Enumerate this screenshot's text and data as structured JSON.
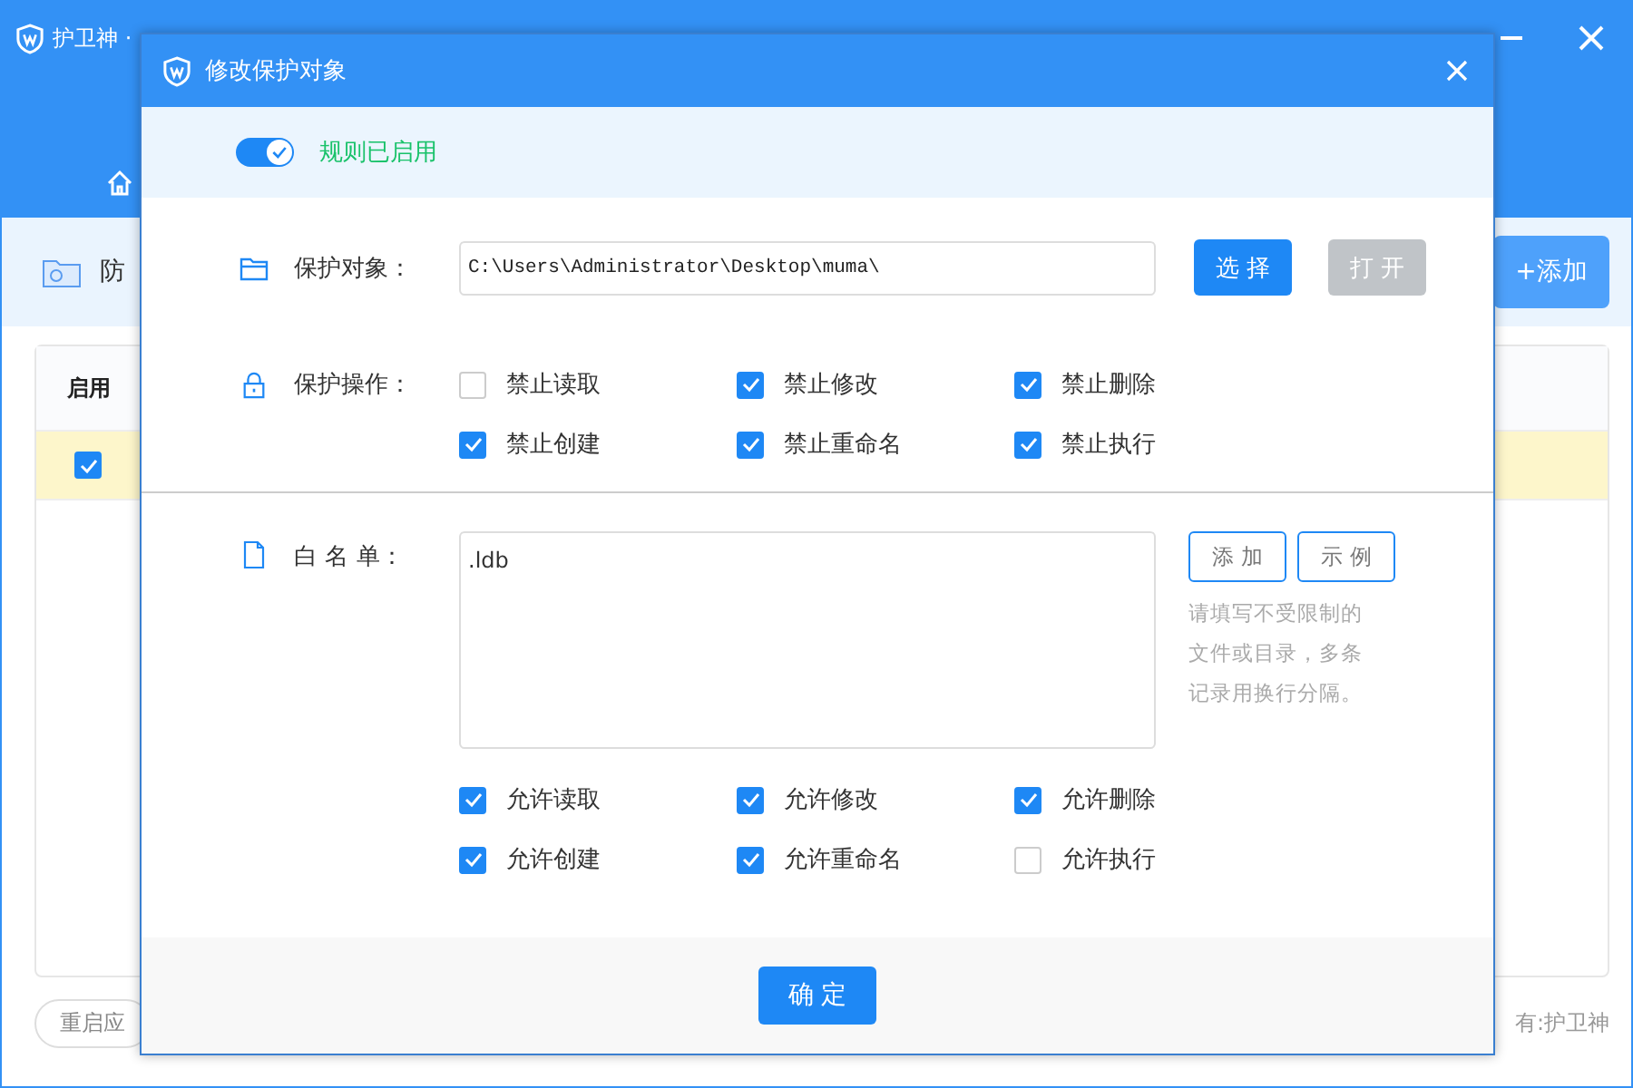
{
  "app": {
    "title": "护卫神 ·",
    "section_title": "防",
    "add_button": "+添加",
    "table": {
      "columns": [
        "启用"
      ],
      "rows": [
        {
          "enabled": true,
          "highlighted": true
        }
      ]
    },
    "restart_button": "重启应",
    "footer_text": "有:护卫神"
  },
  "dialog": {
    "title": "修改保护对象",
    "rule_enabled": true,
    "rule_label": "规则已启用",
    "target_label": "保护对象：",
    "target_path": "C:\\Users\\Administrator\\Desktop\\muma\\",
    "select_button": "选 择",
    "open_button": {
      "label": "打 开",
      "disabled": true
    },
    "operations_label": "保护操作：",
    "operations": [
      {
        "label": "禁止读取",
        "checked": false
      },
      {
        "label": "禁止修改",
        "checked": true
      },
      {
        "label": "禁止删除",
        "checked": true
      },
      {
        "label": "禁止创建",
        "checked": true
      },
      {
        "label": "禁止重命名",
        "checked": true
      },
      {
        "label": "禁止执行",
        "checked": true
      }
    ],
    "whitelist_label": "白 名 单：",
    "whitelist_value": ".ldb",
    "whitelist_add": "添 加",
    "whitelist_example": "示 例",
    "whitelist_hint": "请填写不受限制的文件或目录，多条记录用换行分隔。",
    "permissions": [
      {
        "label": "允许读取",
        "checked": true
      },
      {
        "label": "允许修改",
        "checked": true
      },
      {
        "label": "允许删除",
        "checked": true
      },
      {
        "label": "允许创建",
        "checked": true
      },
      {
        "label": "允许重命名",
        "checked": true
      },
      {
        "label": "允许执行",
        "checked": false
      }
    ],
    "confirm_button": "确 定"
  }
}
